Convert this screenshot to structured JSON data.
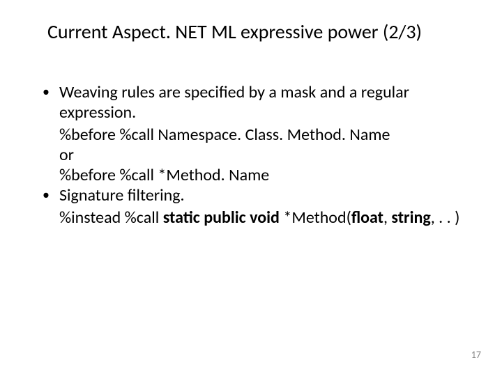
{
  "title": "Current Aspect. NET ML expressive power (2/3)",
  "bullets": [
    {
      "lead": "Weaving rules are specified by a mask and a regular expression.",
      "lines": [
        "%before %call Namespace. Class. Method. Name",
        "or",
        "%before %call *Method. Name"
      ]
    },
    {
      "lead": "Signature filtering.",
      "rich": {
        "prefix": "%instead %call ",
        "b1": "static public void",
        "mid1": " *Method(",
        "b2": "float",
        "mid2": ", ",
        "b3": "string",
        "mid3": ", . . )"
      }
    }
  ],
  "page_number": "17"
}
